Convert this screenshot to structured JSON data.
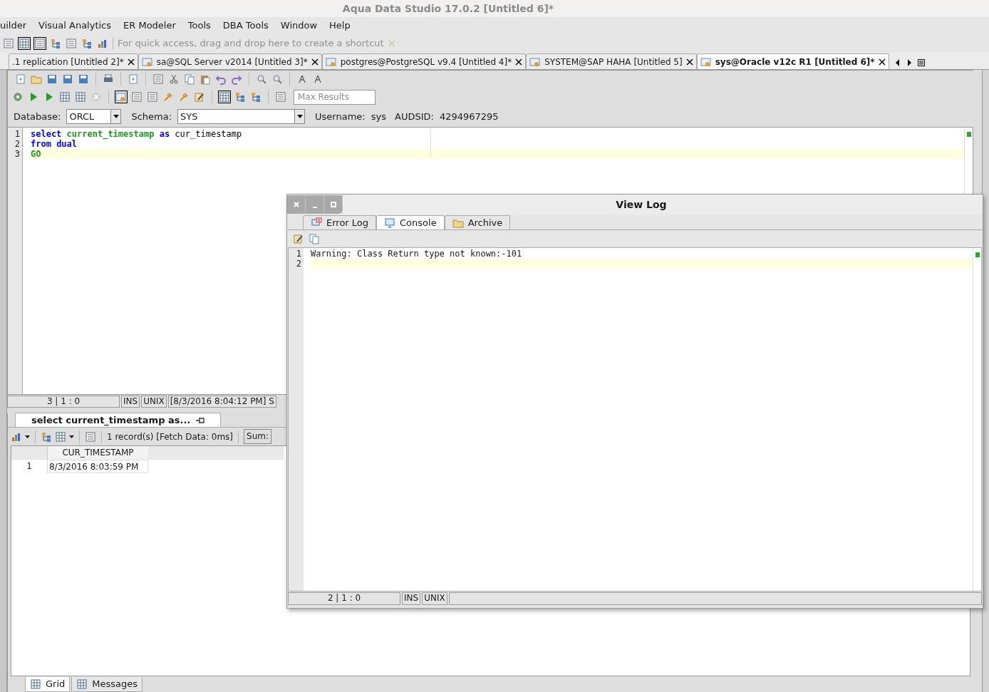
{
  "window": {
    "title": "Aqua Data Studio 17.0.2 [Untitled 6]*"
  },
  "menu": [
    "uilder",
    "Visual Analytics",
    "ER Modeler",
    "Tools",
    "DBA Tools",
    "Window",
    "Help"
  ],
  "quick_access": {
    "hint": "For quick access, drag and drop here to create a shortcut"
  },
  "doc_tabs": [
    {
      "label": ".1 replication [Untitled 2]*",
      "selected": false
    },
    {
      "label": "sa@SQL Server v2014 [Untitled 3]*",
      "selected": false
    },
    {
      "label": "postgres@PostgreSQL v9.4 [Untitled 4]*",
      "selected": false
    },
    {
      "label": "SYSTEM@SAP HAHA [Untitled 5]",
      "selected": false
    },
    {
      "label": "sys@Oracle v12c R1 [Untitled 6]*",
      "selected": true
    }
  ],
  "editor_toolbar": {
    "max_results_placeholder": "Max Results"
  },
  "connection": {
    "database_label": "Database:",
    "database": "ORCL",
    "schema_label": "Schema:",
    "schema": "SYS",
    "username_label": "Username:",
    "username": "sys",
    "audsid_label": "AUDSID:",
    "audsid": "4294967295"
  },
  "editor": {
    "lines": [
      {
        "number": "1",
        "current": false,
        "tokens": [
          {
            "kind": "keyword",
            "text": "select"
          },
          {
            "kind": "function",
            "text": "current_timestamp"
          },
          {
            "kind": "keyword",
            "text": "as"
          },
          {
            "kind": "plain",
            "text": "cur_timestamp"
          }
        ]
      },
      {
        "number": "2",
        "current": false,
        "tokens": [
          {
            "kind": "keyword",
            "text": "from"
          },
          {
            "kind": "keyword",
            "text": "dual"
          }
        ]
      },
      {
        "number": "3",
        "current": true,
        "tokens": [
          {
            "kind": "function",
            "text": "GO"
          }
        ]
      }
    ]
  },
  "editor_status": [
    "3 | 1 : 0",
    "INS",
    "UNIX",
    "[8/3/2016 8:04:12 PM] S"
  ],
  "results": {
    "tab": {
      "label": "select current_timestamp as...",
      "selected": true
    },
    "record_info": "1 record(s) [Fetch Data: 0ms]",
    "sum_label": "Sum:",
    "columns": [
      "CUR_TIMESTAMP"
    ],
    "rows": [
      {
        "number": "1",
        "cells": [
          "8/3/2016 8:03:59 PM"
        ]
      }
    ]
  },
  "bottom_tabs": [
    {
      "label": "Grid",
      "selected": true
    },
    {
      "label": "Messages",
      "selected": false
    }
  ],
  "view_log": {
    "title": "View Log",
    "tabs": [
      {
        "label": "Error Log",
        "selected": false
      },
      {
        "label": "Console",
        "selected": true
      },
      {
        "label": "Archive",
        "selected": false
      }
    ],
    "lines": [
      {
        "number": "1",
        "current": false,
        "text": "Warning: Class Return type not known:-101"
      },
      {
        "number": "2",
        "current": true
      }
    ],
    "status": [
      "2 | 1 : 0",
      "INS",
      "UNIX"
    ]
  }
}
